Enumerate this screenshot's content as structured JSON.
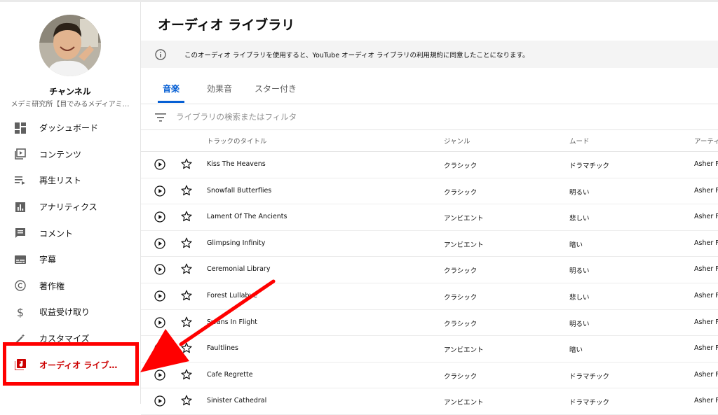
{
  "sidebar": {
    "channel_title": "チャンネル",
    "channel_name": "メデミ研究所【目でみるメディアミ…",
    "items": [
      {
        "label": "ダッシュボード",
        "icon": "dashboard-icon"
      },
      {
        "label": "コンテンツ",
        "icon": "content-icon"
      },
      {
        "label": "再生リスト",
        "icon": "playlist-icon"
      },
      {
        "label": "アナリティクス",
        "icon": "analytics-icon"
      },
      {
        "label": "コメント",
        "icon": "comment-icon"
      },
      {
        "label": "字幕",
        "icon": "subtitles-icon"
      },
      {
        "label": "著作権",
        "icon": "copyright-icon"
      },
      {
        "label": "収益受け取り",
        "icon": "dollar-icon"
      },
      {
        "label": "カスタマイズ",
        "icon": "magic-wand-icon"
      },
      {
        "label": "オーディオ ライブ…",
        "icon": "audio-library-icon"
      }
    ]
  },
  "main": {
    "title": "オーディオ ライブラリ",
    "banner_text": "このオーディオ ライブラリを使用すると、YouTube オーディオ ライブラリの利用規約に同意したことになります。",
    "tabs": [
      {
        "label": "音楽"
      },
      {
        "label": "効果音"
      },
      {
        "label": "スター付き"
      }
    ],
    "filter_placeholder": "ライブラリの検索またはフィルタ",
    "columns": {
      "title": "トラックのタイトル",
      "genre": "ジャンル",
      "mood": "ムード",
      "artist": "アーティ"
    },
    "tracks": [
      {
        "title": "Kiss The Heavens",
        "genre": "クラシック",
        "mood": "ドラマチック",
        "artist": "Asher F"
      },
      {
        "title": "Snowfall Butterflies",
        "genre": "クラシック",
        "mood": "明るい",
        "artist": "Asher F"
      },
      {
        "title": "Lament Of The Ancients",
        "genre": "アンビエント",
        "mood": "悲しい",
        "artist": "Asher F"
      },
      {
        "title": "Glimpsing Infinity",
        "genre": "アンビエント",
        "mood": "暗い",
        "artist": "Asher F"
      },
      {
        "title": "Ceremonial Library",
        "genre": "クラシック",
        "mood": "明るい",
        "artist": "Asher F"
      },
      {
        "title": "Forest Lullabye",
        "genre": "クラシック",
        "mood": "悲しい",
        "artist": "Asher F"
      },
      {
        "title": "Swans In Flight",
        "genre": "クラシック",
        "mood": "明るい",
        "artist": "Asher F"
      },
      {
        "title": "Faultlines",
        "genre": "アンビエント",
        "mood": "暗い",
        "artist": "Asher F"
      },
      {
        "title": "Cafe Regrette",
        "genre": "クラシック",
        "mood": "ドラマチック",
        "artist": "Asher F"
      },
      {
        "title": "Sinister Cathedral",
        "genre": "アンビエント",
        "mood": "ドラマチック",
        "artist": "Asher F"
      }
    ]
  },
  "colors": {
    "accent": "#065fd4",
    "active_nav": "#cc0000",
    "annotation": "#ff0000"
  }
}
